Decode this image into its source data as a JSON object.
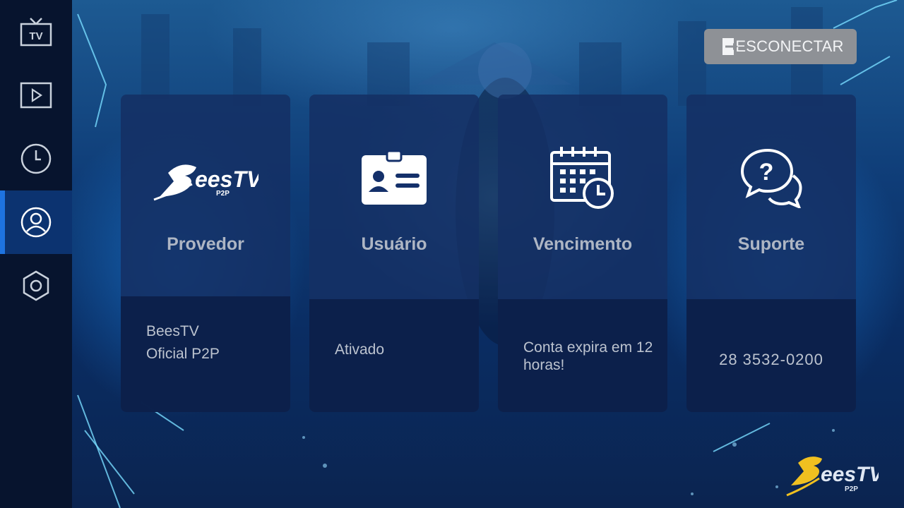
{
  "sidebar": {
    "items": [
      {
        "name": "tv-icon",
        "label": "TV"
      },
      {
        "name": "play-icon",
        "label": ""
      },
      {
        "name": "clock-icon",
        "label": ""
      },
      {
        "name": "user-icon",
        "label": "",
        "active": true
      },
      {
        "name": "settings-icon",
        "label": ""
      }
    ]
  },
  "header": {
    "disconnect_label": "ESCONECTAR",
    "disconnect_icon": "exit-door-icon"
  },
  "cards": {
    "provider": {
      "title": "Provedor",
      "icon": "beestv-logo",
      "logo_text": "eesTV",
      "logo_sub": "P2P",
      "lines": [
        "BeesTV",
        "Oficial P2P"
      ]
    },
    "user": {
      "title": "Usuário",
      "icon": "id-card-icon",
      "status": "Ativado"
    },
    "expiry": {
      "title": "Vencimento",
      "icon": "calendar-clock-icon",
      "text": "Conta expira em 12 horas!"
    },
    "support": {
      "title": "Suporte",
      "icon": "help-chat-icon",
      "phone": "28 3532-0200"
    }
  },
  "corner_logo": {
    "text": "eesTV",
    "sub": "P2P"
  },
  "colors": {
    "sidebar_bg": "#07142e",
    "active_accent": "#1e73e0",
    "card_bg": "#14306a",
    "button_gray": "#8e9196",
    "logo_gold": "#f0c020"
  }
}
